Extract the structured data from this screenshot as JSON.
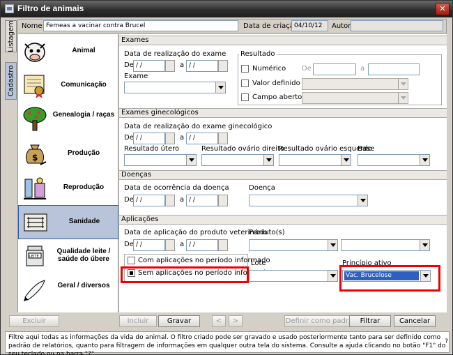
{
  "window": {
    "title": "Filtro de animais"
  },
  "vtabs": {
    "listagem": "Listagem",
    "cadastro": "Cadastro"
  },
  "header": {
    "nome_label": "Nome:",
    "nome_value": "Femeas a vacinar contra Brucel",
    "data_label": "Data de criação:",
    "data_value": "04/10/12",
    "autor_label": "Autor:",
    "autor_value": ""
  },
  "categories": [
    {
      "label": "Animal",
      "icon": "cow-icon"
    },
    {
      "label": "Comunicação",
      "icon": "certificate-icon"
    },
    {
      "label": "Genealogia / raças",
      "icon": "tree-icon"
    },
    {
      "label": "Produção",
      "icon": "money-bag-icon"
    },
    {
      "label": "Reprodução",
      "icon": "lab-icon"
    },
    {
      "label": "Sanidade",
      "icon": "syringes-icon"
    },
    {
      "label": "Qualidade leite / saúde do úbere",
      "icon": "milk-can-icon"
    },
    {
      "label": "Geral / diversos",
      "icon": "pen-icon"
    }
  ],
  "exames": {
    "title": "Exames",
    "data_label": "Data de realização do exame",
    "de": "De",
    "a": "a",
    "date_placeholder": "/ /",
    "exame_label": "Exame",
    "resultado_title": "Resultado",
    "numerico": "Numérico",
    "valor_definido": "Valor definido",
    "campo_aberto": "Campo aberto"
  },
  "ginec": {
    "title": "Exames ginecológicos",
    "data_label": "Data de realização do exame ginecológico",
    "res_utero": "Resultado útero",
    "res_dir": "Resultado ovário direito",
    "res_esq": "Resultado ovário esquerdo",
    "base": "Base"
  },
  "doencas": {
    "title": "Doenças",
    "data_label": "Data de ocorrência da doença",
    "doenca_label": "Doença"
  },
  "aplicacoes": {
    "title": "Aplicações",
    "data_label": "Data de aplicação do produto veterinário",
    "produto_label": "Produto(s)",
    "com_aplic": "Com aplicações no período informado",
    "sem_aplic": "Sem aplicações no período informado",
    "lote_label": "Lote",
    "principio_label": "Princípio ativo",
    "principio_value": "Vac. Brucelose"
  },
  "buttons": {
    "excluir": "Excluir",
    "incluir": "Incluir",
    "gravar": "Gravar",
    "prev": "<",
    "next": ">",
    "definir": "Definir como padrão",
    "filtrar": "Filtrar",
    "cancelar": "Cancelar"
  },
  "status": {
    "text": "Filtre aqui todas as informações da vida do animal. O filtro criado pode ser gravado e usado posteriormente tanto para ser definido como padrão de relatórios, quanto para filtragem de informações em qualquer outra tela do sistema. Consulte a ajuda clicando no botão \"F1\" do seu teclado ou na barra \"?\"",
    "help": "?"
  },
  "colors": {
    "highlight": "#2f5fbf",
    "annotation": "#e00000",
    "selected_category": "#b8c4da"
  }
}
